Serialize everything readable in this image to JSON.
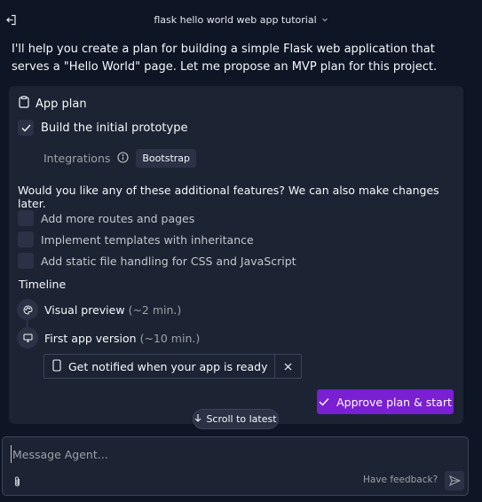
{
  "header": {
    "title": "flask hello world web app tutorial",
    "back_icon": "exit-panel-icon",
    "title_chevron_icon": "chevron-down-icon"
  },
  "intro_text": "I'll help you create a plan for building a simple Flask web application that serves a \"Hello World\" page. Let me propose an MVP plan for this project.",
  "plan": {
    "title": "App plan",
    "title_icon": "clipboard-icon",
    "main_task": {
      "label": "Build the initial prototype",
      "checked": true
    },
    "integrations_label": "Integrations",
    "integrations_info_icon": "info-icon",
    "integration_tag": "Bootstrap",
    "question": "Would you like any of these additional features? We can also make changes later.",
    "features": [
      {
        "label": "Add more routes and pages",
        "checked": false
      },
      {
        "label": "Implement templates with inheritance",
        "checked": false
      },
      {
        "label": "Add static file handling for CSS and JavaScript",
        "checked": false
      }
    ],
    "timeline_label": "Timeline",
    "timeline": [
      {
        "icon": "palette-icon",
        "label": "Visual preview",
        "duration": "(~2 min.)"
      },
      {
        "icon": "monitor-icon",
        "label": "First app version",
        "duration": "(~10 min.)"
      }
    ],
    "notify": {
      "label": "Get notified when your app is ready",
      "icon": "phone-icon",
      "close_icon": "close-icon"
    },
    "approve_label": "Approve plan & start",
    "approve_icon": "check-icon"
  },
  "scroll_latest_label": "Scroll to latest",
  "composer": {
    "placeholder": "Message Agent...",
    "feedback_label": "Have feedback?",
    "attach_icon": "paperclip-icon",
    "send_icon": "send-icon"
  },
  "colors": {
    "background": "#0e1525",
    "card": "#1c2333",
    "control": "#2b3245",
    "border": "#3c445c",
    "accent": "#7a1fd1",
    "muted_text": "#9da2a6"
  }
}
